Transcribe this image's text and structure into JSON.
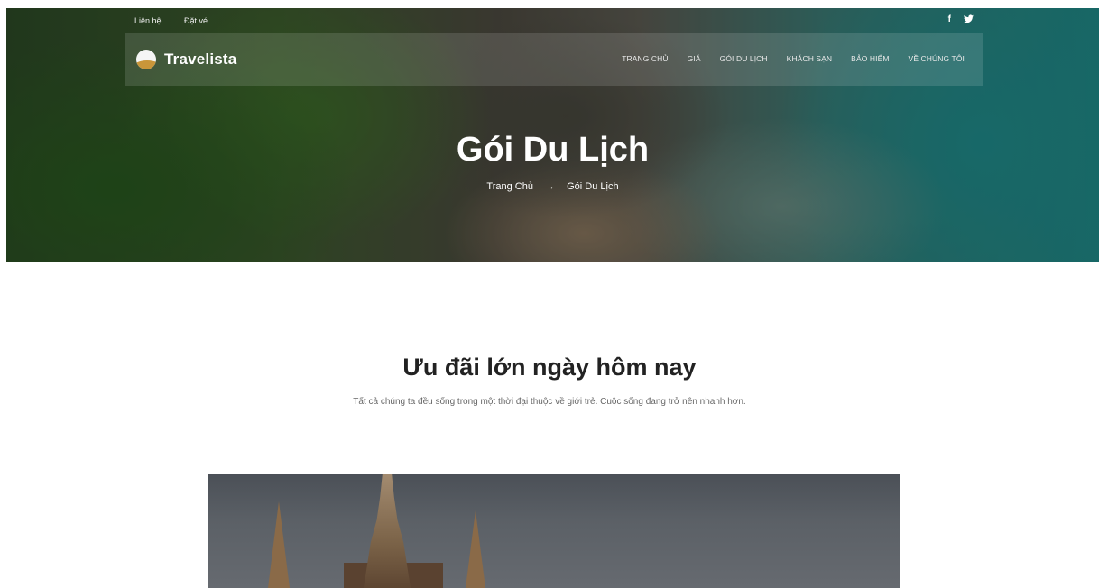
{
  "topbar": {
    "links": [
      "Liên hệ",
      "Đặt vé"
    ],
    "social": [
      {
        "icon": "facebook-icon",
        "glyph": "f"
      },
      {
        "icon": "twitter-icon",
        "glyph": "t"
      }
    ]
  },
  "brand": {
    "name": "Travelista",
    "logo_icon": "travelista-logo-icon"
  },
  "nav": {
    "items": [
      "TRANG CHỦ",
      "GIÁ",
      "GÓI DU LỊCH",
      "KHÁCH SẠN",
      "BẢO HIỂM",
      "VỀ CHÚNG TÔI"
    ]
  },
  "hero": {
    "title": "Gói Du Lịch",
    "breadcrumb": {
      "home": "Trang Chủ",
      "arrow": "→",
      "current": "Gói Du Lịch"
    }
  },
  "section": {
    "title": "Ưu đãi lớn ngày hôm nay",
    "subtitle": "Tất cả chúng ta đều sống trong một thời đại thuộc về giới trẻ. Cuộc sống đang trở nên nhanh hơn."
  },
  "colors": {
    "accent": "#c9963a",
    "text": "#222222",
    "muted": "#666666"
  }
}
